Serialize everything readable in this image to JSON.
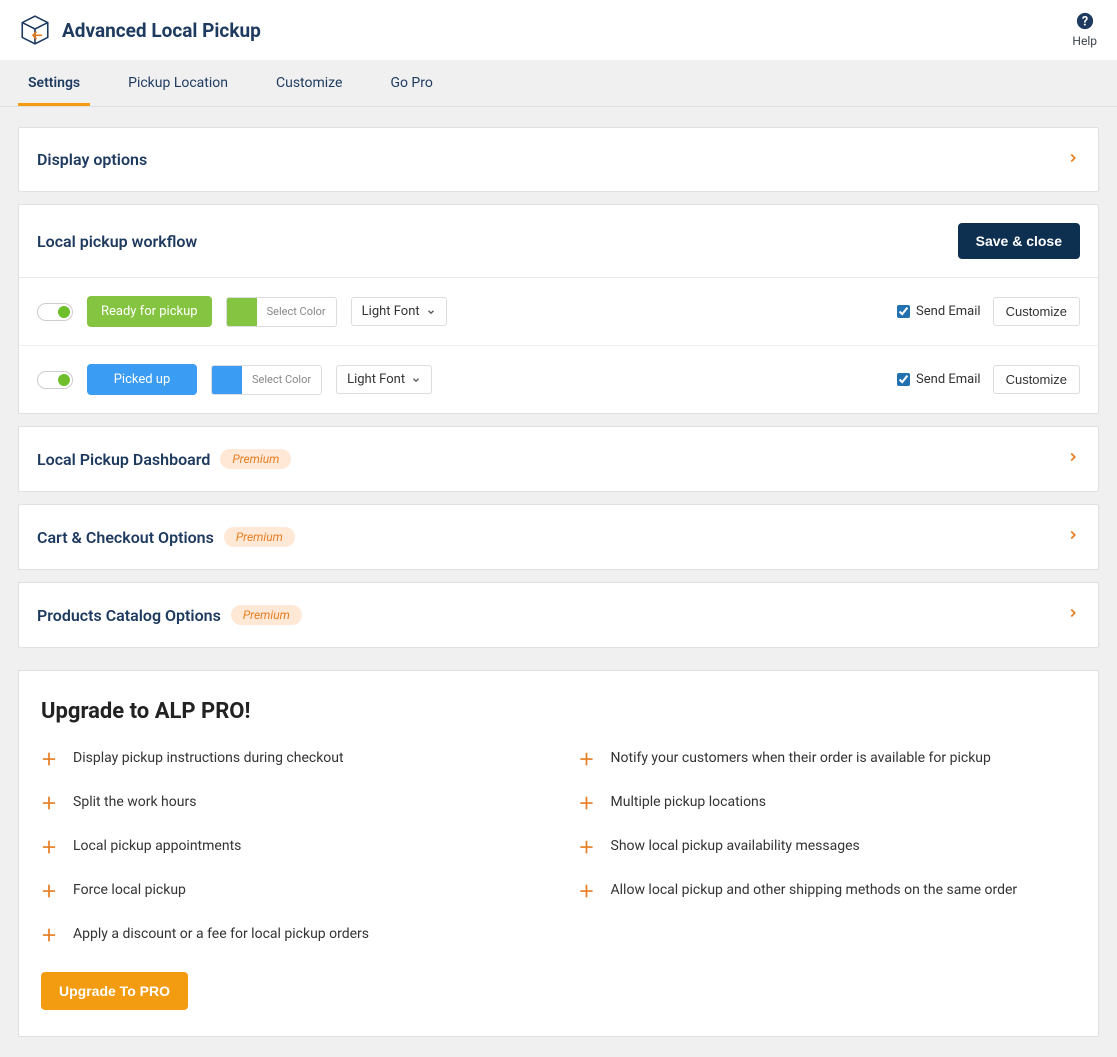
{
  "header": {
    "title": "Advanced Local Pickup",
    "help_label": "Help"
  },
  "tabs": [
    {
      "label": "Settings",
      "active": true
    },
    {
      "label": "Pickup Location",
      "active": false
    },
    {
      "label": "Customize",
      "active": false
    },
    {
      "label": "Go Pro",
      "active": false
    }
  ],
  "panels": {
    "display_options": {
      "title": "Display options"
    },
    "workflow": {
      "title": "Local pickup workflow",
      "save_button": "Save & close",
      "rows": [
        {
          "status_label": "Ready for pickup",
          "color_hex": "#85c441",
          "select_color_label": "Select Color",
          "font_label": "Light Font",
          "send_email_label": "Send Email",
          "send_email_checked": true,
          "customize_label": "Customize"
        },
        {
          "status_label": "Picked up",
          "color_hex": "#3a9cf3",
          "select_color_label": "Select Color",
          "font_label": "Light Font",
          "send_email_label": "Send Email",
          "send_email_checked": true,
          "customize_label": "Customize"
        }
      ]
    },
    "dashboard": {
      "title": "Local Pickup Dashboard",
      "badge": "Premium"
    },
    "cart": {
      "title": "Cart & Checkout Options",
      "badge": "Premium"
    },
    "catalog": {
      "title": "Products Catalog Options",
      "badge": "Premium"
    }
  },
  "upgrade": {
    "title": "Upgrade to ALP PRO!",
    "features_left": [
      "Display pickup instructions during checkout",
      "Split the work hours",
      "Local pickup appointments",
      "Force local pickup",
      "Apply a discount or a fee for local pickup orders"
    ],
    "features_right": [
      "Notify your customers when their order is available for pickup",
      "Multiple pickup locations",
      "Show local pickup availability messages",
      "Allow local pickup and other shipping methods on the same order"
    ],
    "button": "Upgrade To PRO"
  }
}
